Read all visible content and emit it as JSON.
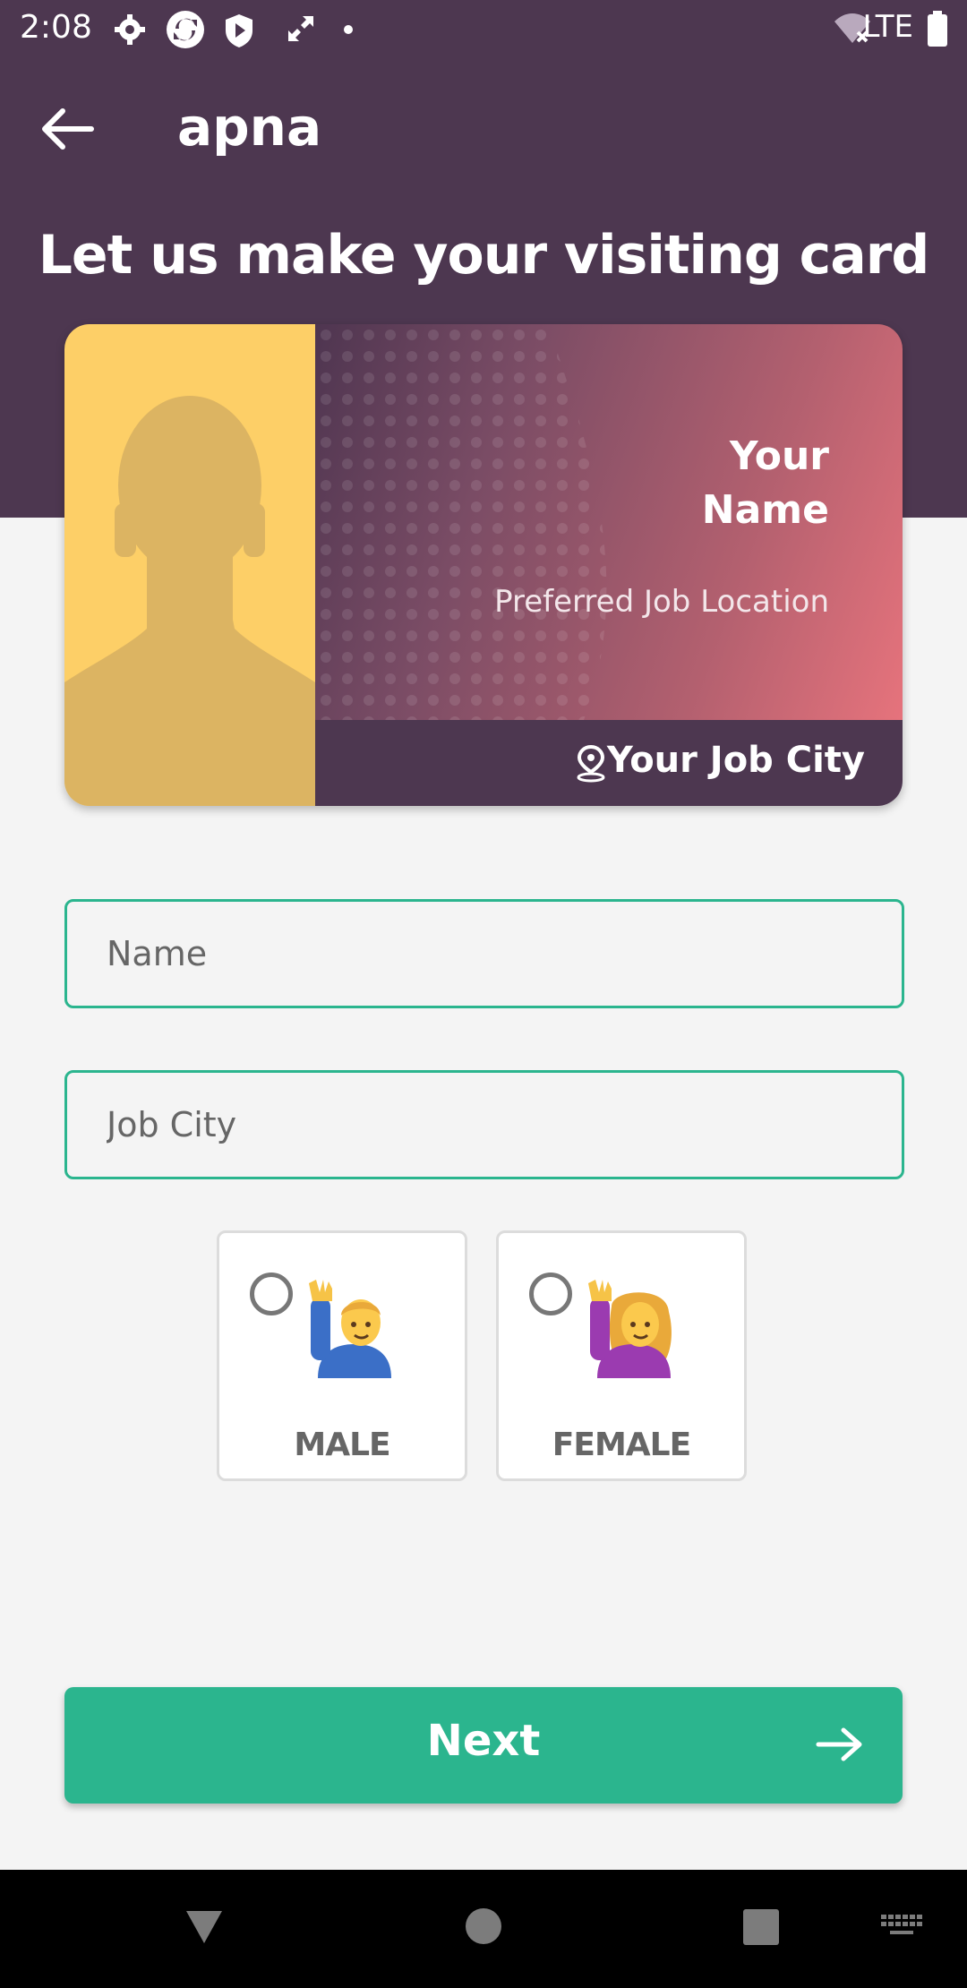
{
  "status_bar": {
    "time": "2:08",
    "network": "LTE",
    "icons": [
      "gear-icon",
      "sync-icon",
      "shield-icon",
      "expand-icon",
      "dot-icon",
      "wifi-icon",
      "battery-icon"
    ]
  },
  "header": {
    "app_name": "apna",
    "back_icon": "back-arrow-icon"
  },
  "page": {
    "heading": "Let us make your visiting card"
  },
  "card": {
    "name": "Your Name",
    "location": "Preferred Job Location",
    "city": "Your Job City",
    "pin_icon": "location-pin-icon"
  },
  "form": {
    "name_placeholder": "Name",
    "name_value": "",
    "city_placeholder": "Job City",
    "city_value": "",
    "genders": [
      {
        "label": "MALE",
        "selected": false,
        "icon": "man-raising-hand-icon"
      },
      {
        "label": "FEMALE",
        "selected": false,
        "icon": "woman-raising-hand-icon"
      }
    ]
  },
  "next_button": {
    "label": "Next",
    "icon": "arrow-right-icon"
  },
  "colors": {
    "primary": "#4d3750",
    "accent": "#2bb58e",
    "card_photo_bg": "#fdcf67",
    "background": "#f4f4f4"
  },
  "nav_bar": {
    "icons": [
      "back-triangle-icon",
      "home-circle-icon",
      "recents-square-icon",
      "keyboard-icon"
    ]
  }
}
